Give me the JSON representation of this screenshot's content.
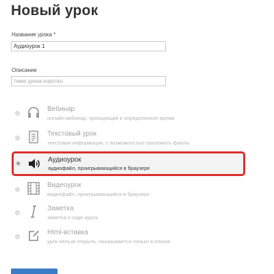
{
  "page": {
    "title": "Новый урок"
  },
  "form": {
    "name_label": "Название урока *",
    "name_value": "Аудиоурок 1",
    "description_label": "Описание",
    "description_placeholder": "тема урока коротко"
  },
  "lesson_types": [
    {
      "title": "Вебинар",
      "description": "онлайн-вебинар, проходящий в определенное время",
      "icon": "headphones-icon",
      "selected": false
    },
    {
      "title": "Текстовый урок",
      "description": "текстовая информация, с возможностью приложить файлы",
      "icon": "document-icon",
      "selected": false
    },
    {
      "title": "Аудиоурок",
      "description": "аудиофайл, проигрывающийся в браузере",
      "icon": "speaker-icon",
      "selected": true
    },
    {
      "title": "Видеоурок",
      "description": "видеофайл, проигрывающийся в браузере",
      "icon": "film-icon",
      "selected": false
    },
    {
      "title": "Заметка",
      "description": "заметка о ходе курса",
      "icon": "italic-i-icon",
      "selected": false
    },
    {
      "title": "Html-вставка",
      "description": "урок нельзя открыть. показывается только в списке",
      "icon": "edit-icon",
      "selected": false
    }
  ],
  "colors": {
    "selection_border": "#d9302e",
    "primary_button": "#3a7cc5",
    "inactive_text": "#a3a3a3"
  }
}
